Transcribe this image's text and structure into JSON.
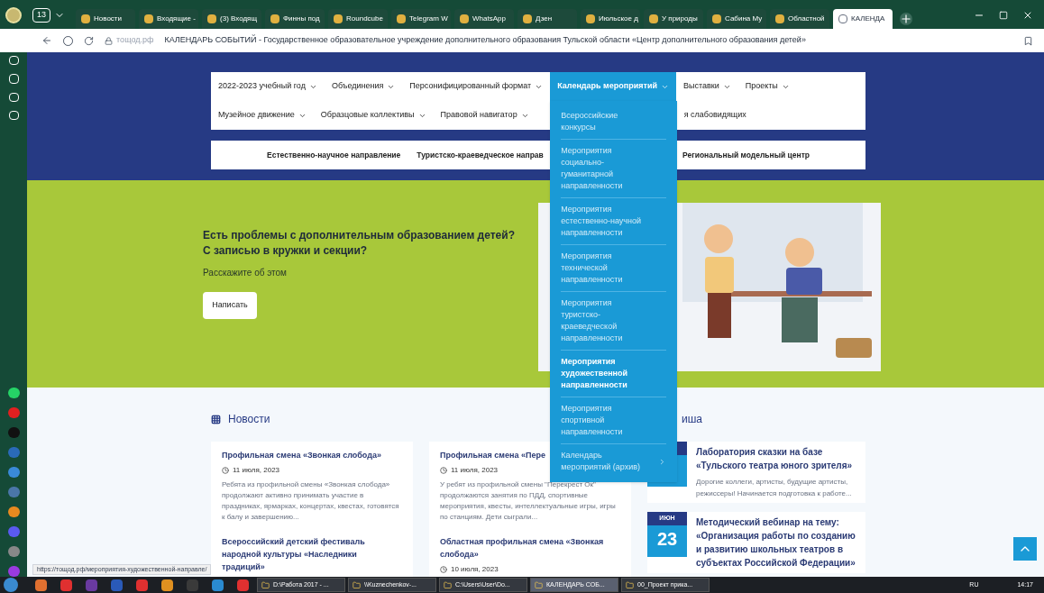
{
  "browser": {
    "tabs": [
      {
        "label": "Новости",
        "selected": false
      },
      {
        "label": "Входящие -",
        "selected": false
      },
      {
        "label": "(3) Входящ",
        "selected": false
      },
      {
        "label": "Финны под",
        "selected": false
      },
      {
        "label": "Roundcube",
        "selected": false
      },
      {
        "label": "Telegram W",
        "selected": false
      },
      {
        "label": "WhatsApp",
        "selected": false
      },
      {
        "label": "Дзен",
        "selected": false
      },
      {
        "label": "Июльское д",
        "selected": false
      },
      {
        "label": "У природы",
        "selected": false
      },
      {
        "label": "Сабина Му",
        "selected": false
      },
      {
        "label": "Областной",
        "selected": false
      },
      {
        "label": "КАЛЕНДА",
        "selected": true
      }
    ],
    "tab_count": "13",
    "address": {
      "domain": "тoщод.рф",
      "title": "КАЛЕНДАРЬ СОБЫТИЙ - Государственное образовательное учреждение дополнительного образования Тульской области «Центр дополнительного образования детей»"
    }
  },
  "nav": {
    "items": [
      {
        "label": "2022-2023 учебный год",
        "selected": false,
        "has_caret": true
      },
      {
        "label": "Объединения",
        "selected": false,
        "has_caret": true
      },
      {
        "label": "Персонифицированный формат",
        "selected": false,
        "has_caret": true
      },
      {
        "label": "Календарь мероприятий",
        "selected": true,
        "has_caret": true
      },
      {
        "label": "Выставки",
        "selected": false,
        "has_caret": true
      },
      {
        "label": "Проекты",
        "selected": false,
        "has_caret": true
      },
      {
        "label": "Музейное движение",
        "selected": false,
        "has_caret": true
      },
      {
        "label": "Образцовые коллективы",
        "selected": false,
        "has_caret": true
      },
      {
        "label": "Правовой навигатор",
        "selected": false,
        "has_caret": true
      },
      {
        "label": "я слабовидящих",
        "selected": false,
        "has_caret": false
      }
    ]
  },
  "dropdown": [
    {
      "label": "Всероссийские конкурсы",
      "selected": false,
      "has_submenu": false
    },
    {
      "label": "Мероприятия социально-гуманитарной направленности",
      "selected": false,
      "has_submenu": false
    },
    {
      "label": "Мероприятия естественно-научной направленности",
      "selected": false,
      "has_submenu": false
    },
    {
      "label": "Мероприятия технической направленности",
      "selected": false,
      "has_submenu": false
    },
    {
      "label": "Мероприятия туристско-краеведческой направленности",
      "selected": false,
      "has_submenu": false
    },
    {
      "label": "Мероприятия художественной направленности",
      "selected": true,
      "has_submenu": false
    },
    {
      "label": "Мероприятия спортивной направленности",
      "selected": false,
      "has_submenu": false
    },
    {
      "label": "Календарь мероприятий (архив)",
      "selected": false,
      "has_submenu": true
    }
  ],
  "directions": [
    "Естественно-научное направление",
    "Туристско-краеведческое направ",
    "Региональный модельный центр"
  ],
  "banner": {
    "lines": [
      "Есть проблемы с дополнительным образованием детей?",
      "С записью в кружки и секции?"
    ],
    "subtitle": "Расскажите об этом",
    "button": "Написать"
  },
  "news": {
    "heading": "Новости",
    "columns": [
      [
        {
          "title": "Профильная смена «Звонкая слобода»",
          "date": "11 июля, 2023",
          "excerpt": "Ребята из профильной смены «Звонкая слобода» продолжают активно принимать участие в праздниках, ярмарках, концертах, квестах, готовятся к балу и завершению..."
        },
        {
          "title": "Всероссийский детский фестиваль народной культуры «Наследники традиций»"
        }
      ],
      [
        {
          "title": "Профильная смена «Пере",
          "date": "11 июля, 2023",
          "excerpt": "У ребят из профильной смены \"Перекрест Ок\" продолжаются занятия по ПДД, спортивные мероприятия, квесты, интеллектуальные игры, игры по станциям. Дети сыграли..."
        },
        {
          "title": "Областная профильная смена «Звонкая слобода»",
          "date": "10 июля, 2023"
        }
      ]
    ]
  },
  "afisha": {
    "heading": "иша",
    "events": [
      {
        "title": "Лаборатория сказки на базе «Тульского театра юного зрителя»",
        "excerpt": "Дорогие коллеги, артисты, будущие артисты, режиссеры! Начинается подготовка к работе..."
      },
      {
        "month": "ИЮН",
        "day": "23",
        "title": "Методический вебинар на тему: «Организация работы по созданию и развитию школьных театров в субъектах Российской Федерации»"
      }
    ]
  },
  "status_url": "https://тoщод.рф/мероприятия-художественной-направле/",
  "taskbar": {
    "items": [
      {
        "label": "D:\\Работа 2017 - ...",
        "selected": false
      },
      {
        "label": "\\\\Kuznechenkov-...",
        "selected": false
      },
      {
        "label": "C:\\Users\\User\\Do...",
        "selected": false
      },
      {
        "label": "КАЛЕНДАРЬ СОБ...",
        "selected": true
      },
      {
        "label": "00_Проект прика...",
        "selected": false
      }
    ],
    "lang": "RU",
    "time": "14:17"
  }
}
